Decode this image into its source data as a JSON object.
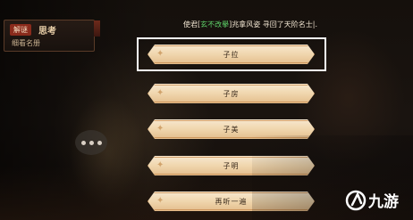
{
  "panel": {
    "tag": "解谜",
    "title": "思考",
    "subtitle": "细看名册"
  },
  "hint": {
    "prefix": "使君[",
    "highlight": "玄不改擧",
    "suffix": "]兆拿风姿 寻回了天阶名士|."
  },
  "options": [
    {
      "label": "子拉",
      "selected": true
    },
    {
      "label": "子房",
      "selected": false
    },
    {
      "label": "子美",
      "selected": false
    },
    {
      "label": "子明",
      "selected": false
    },
    {
      "label": "再听一遍",
      "selected": false
    }
  ],
  "watermark": {
    "text": "九游"
  },
  "colors": {
    "highlight_green": "#5fd46a",
    "tag_red": "#8a2b1c",
    "option_fill": "#f0d6ad"
  }
}
